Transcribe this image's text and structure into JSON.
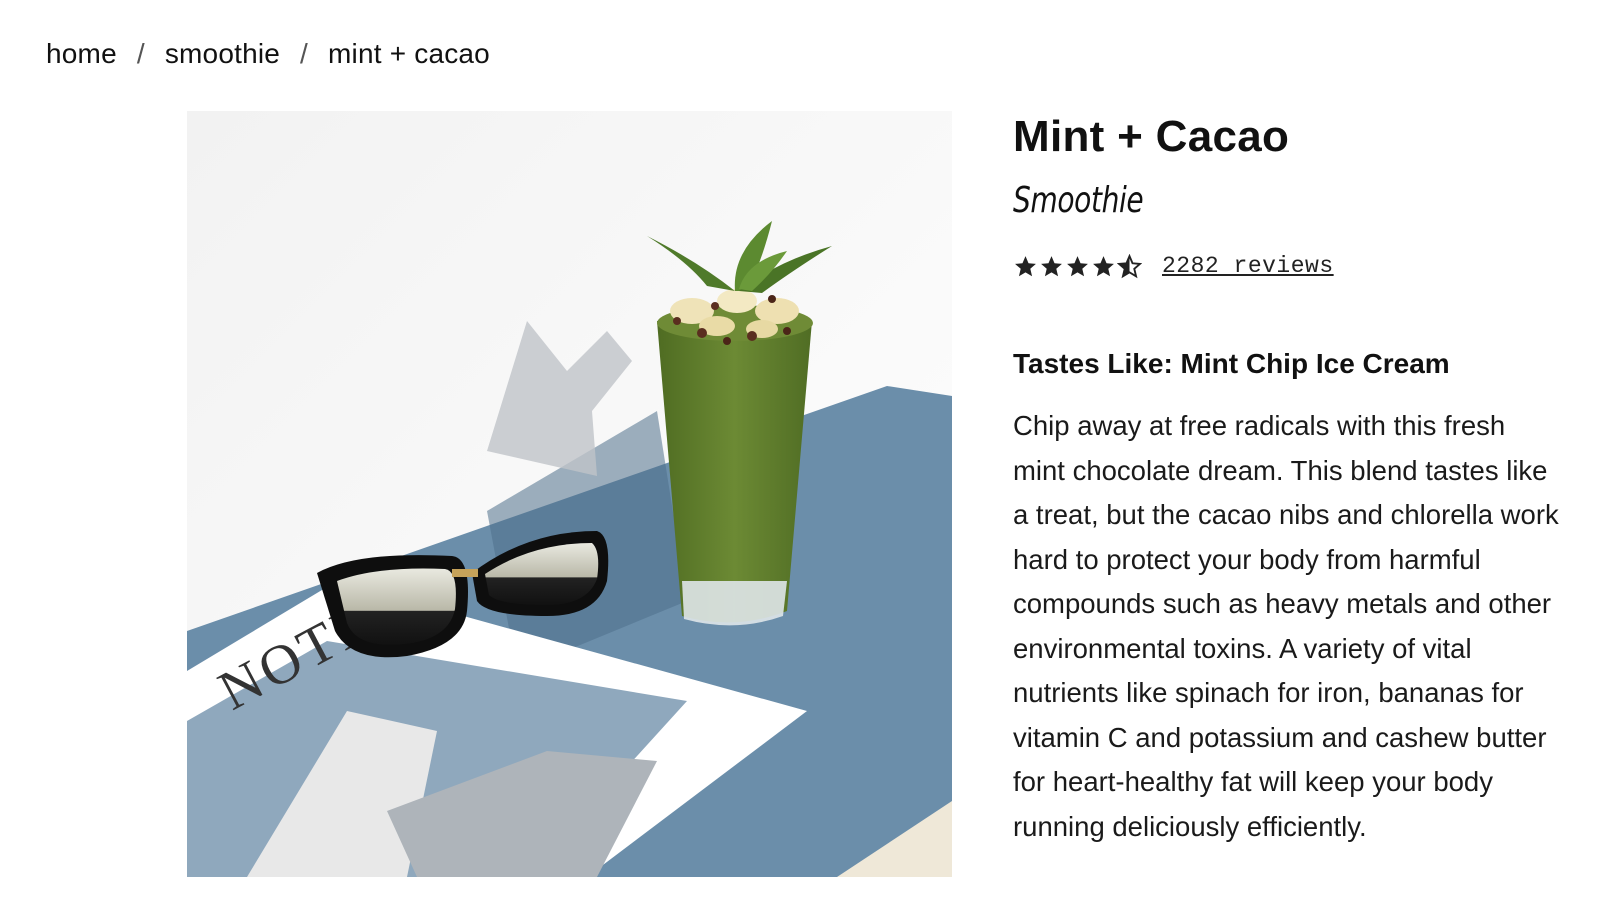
{
  "breadcrumb": {
    "items": [
      "home",
      "smoothie",
      "mint + cacao"
    ],
    "separator": "/"
  },
  "product": {
    "title": "Mint + Cacao",
    "category": "Smoothie",
    "rating": 4.5,
    "reviews_label": "2282 reviews",
    "tastes_like": "Tastes Like: Mint Chip Ice Cream",
    "description_lines": [
      "Chip away at free radicals with this fresh",
      "mint chocolate dream. This blend tastes like",
      "a treat, but the cacao nibs and chlorella work",
      "hard to protect your body from harmful",
      "compounds such as heavy metals and other",
      "environmental toxins. A variety of vital",
      "nutrients like spinach for iron, bananas for",
      "vitamin C and potassium and cashew butter",
      "for heart-healthy fat will keep your body",
      "running deliciously efficiently."
    ]
  },
  "image": {
    "magazine_text": "NOTE",
    "colors": {
      "background": "#f4f4f4",
      "table_blue": "#6b8eaa",
      "smoothie_green": "#5d7a2c",
      "mint_leaf": "#4f7a2a"
    }
  }
}
